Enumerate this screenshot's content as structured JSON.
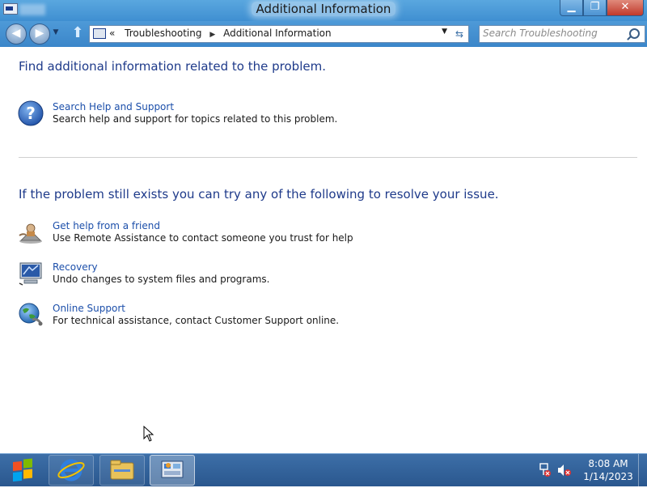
{
  "window": {
    "title": "Additional Information"
  },
  "window_controls": {
    "minimize": "▁",
    "restore": "❐",
    "close": "✕"
  },
  "address_bar": {
    "overflow": "«",
    "crumbs": [
      "Troubleshooting",
      "Additional Information"
    ],
    "dropdown": "▼"
  },
  "search": {
    "placeholder": "Search Troubleshooting"
  },
  "section1": {
    "heading": "Find additional information related to the problem.",
    "items": [
      {
        "title": "Search Help and Support",
        "description": "Search help and support for topics related to this problem.",
        "icon": "help-icon"
      }
    ]
  },
  "section2": {
    "heading": "If the problem still exists you can try any of the following to resolve your issue.",
    "items": [
      {
        "title": "Get help from a friend",
        "description": "Use Remote Assistance to contact someone you trust for help",
        "icon": "remote-assistance-icon"
      },
      {
        "title": "Recovery",
        "description": "Undo changes to system files and programs.",
        "icon": "recovery-icon"
      },
      {
        "title": "Online Support",
        "description": "For technical assistance, contact Customer Support online.",
        "icon": "globe-icon"
      }
    ]
  },
  "taskbar": {
    "pinned": [
      "internet-explorer-icon",
      "file-explorer-icon",
      "control-panel-icon"
    ],
    "clock": {
      "time": "8:08 AM",
      "date": "1/14/2023"
    }
  },
  "colors": {
    "link": "#1c4faa",
    "heading": "#1e3a8a",
    "taskbar": "#2a578e",
    "titlebar": "#4e9ad8"
  }
}
